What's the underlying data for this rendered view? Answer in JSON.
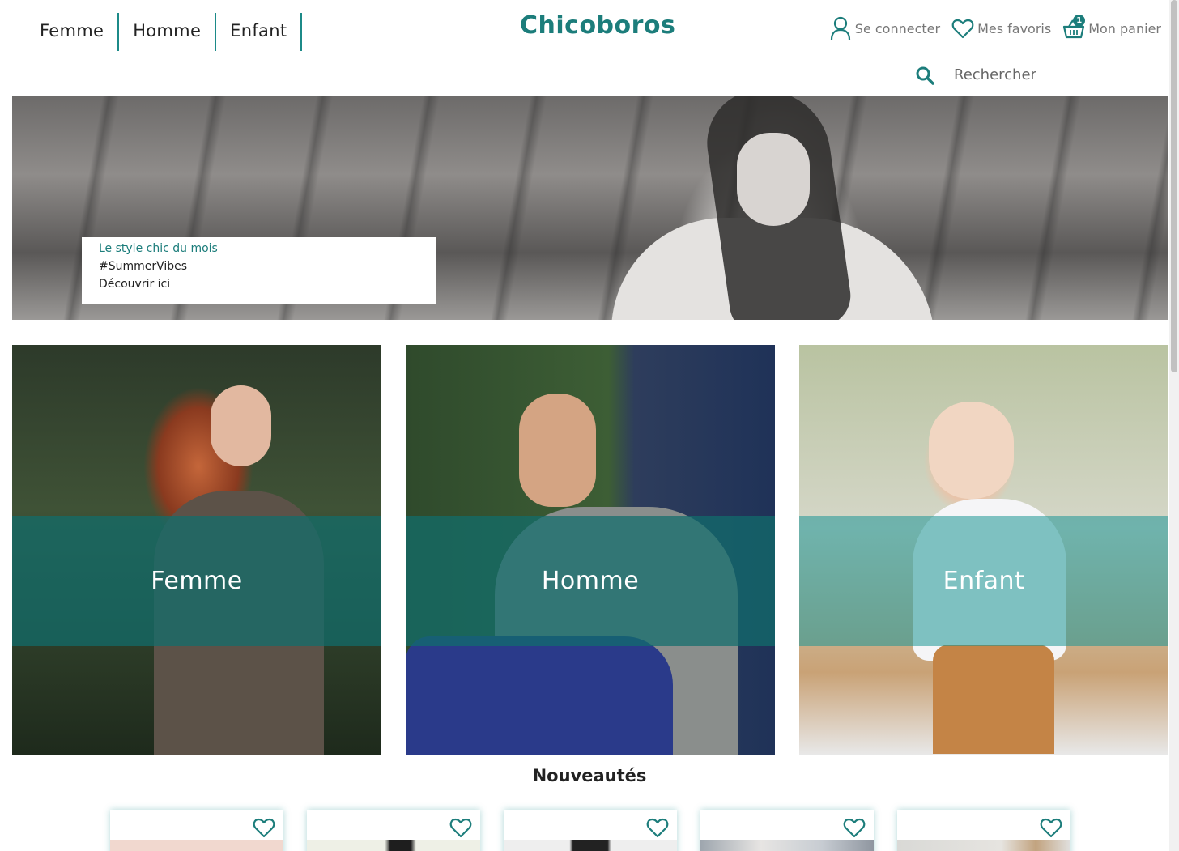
{
  "nav": {
    "items": [
      {
        "label": "Femme"
      },
      {
        "label": "Homme"
      },
      {
        "label": "Enfant"
      }
    ]
  },
  "brand": {
    "logo_text": "Chicoboros",
    "color": "#1c7d7b"
  },
  "account": {
    "login_label": "Se connecter",
    "favorites_label": "Mes favoris",
    "cart_label": "Mon panier",
    "cart_count": "1"
  },
  "search": {
    "placeholder": "Rechercher"
  },
  "hero": {
    "line1": "Le style chic du mois",
    "line2": "#SummerVibes",
    "line3": "Découvrir ici"
  },
  "categories": [
    {
      "label": "Femme"
    },
    {
      "label": "Homme"
    },
    {
      "label": "Enfant"
    }
  ],
  "new_arrivals": {
    "title": "Nouveautés"
  },
  "colors": {
    "accent": "#1c7d7b",
    "band": "#106e6c"
  }
}
